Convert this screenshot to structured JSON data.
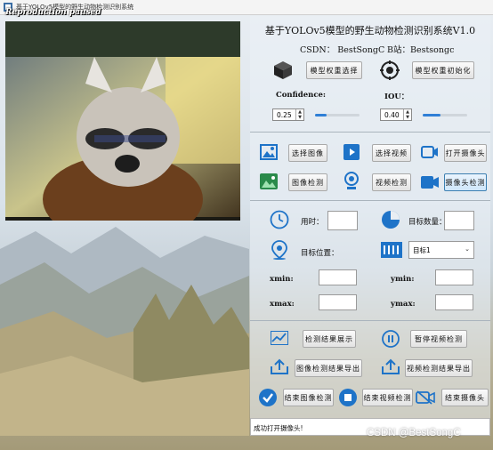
{
  "window": {
    "title": "基于YOLOv5模型的野生动物检测识别系统",
    "overlay_text": "Reproduction paused"
  },
  "header": {
    "title": "基于YOLOv5模型的野生动物检测识别系统V1.0",
    "csdn": "CSDN： BestSongC",
    "bilibili": "B站：Bestsongc"
  },
  "model": {
    "select_label": "模型权重选择",
    "init_label": "模型权重初始化"
  },
  "params": {
    "confidence_label": "Confidence:",
    "confidence_value": "0.25",
    "iou_label": "IOU：",
    "iou_value": "0.40",
    "confidence_slider": 0.25,
    "iou_slider": 0.4
  },
  "sources": {
    "select_image": "选择图像",
    "select_video": "选择视频",
    "open_camera": "打开摄像头",
    "image_detect": "图像检测",
    "video_detect": "视频检测",
    "camera_detect": "摄像头检测"
  },
  "results": {
    "time_label": "用时：",
    "count_label": "目标数量：",
    "position_label": "目标位置：",
    "target_selected": "目标1",
    "xmin_label": "xmin:",
    "ymin_label": "ymin:",
    "xmax_label": "xmax:",
    "ymax_label": "ymax:"
  },
  "actions": {
    "show_results": "检测结果展示",
    "pause_video": "暂停视频检测",
    "export_image": "图像检测结果导出",
    "export_video": "视频检测结果导出",
    "end_image": "结束图像检测",
    "end_video": "结束视频检测",
    "end_camera": "结束摄像头"
  },
  "status": {
    "message": "成功打开摄像头!"
  },
  "watermark": "CSDN @BestSongC",
  "colors": {
    "accent": "#2f7fd6",
    "icon_blue": "#1e73c8"
  }
}
